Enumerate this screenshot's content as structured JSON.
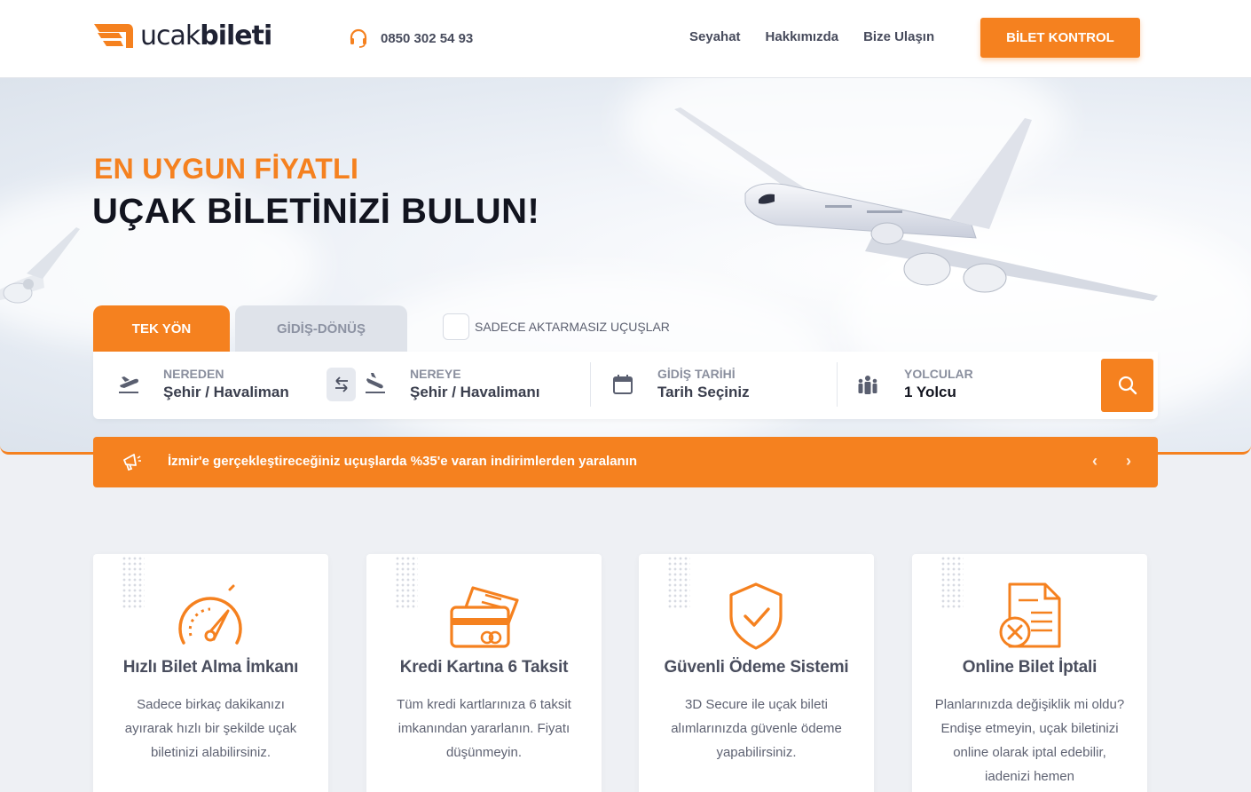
{
  "header": {
    "logo_part1": "ucak",
    "logo_part2": "bileti",
    "phone": "0850 302 54 93",
    "nav": [
      "Seyahat",
      "Hakkımızda",
      "Bize Ulaşın"
    ],
    "cta": "BİLET KONTROL"
  },
  "hero": {
    "subtitle": "EN UYGUN FİYATLI",
    "title": "UÇAK BİLETİNİZİ BULUN!"
  },
  "search": {
    "tabs": [
      "TEK YÖN",
      "GİDİŞ-DÖNÜŞ"
    ],
    "active_tab": "TEK YÖN",
    "direct_only_label": "SADECE AKTARMASIZ UÇUŞLAR",
    "from_label": "NEREDEN",
    "from_value": "Şehir / Havalimanı",
    "to_label": "NEREYE",
    "to_value": "Şehir / Havalimanı",
    "date_label": "GİDİŞ TARİHİ",
    "date_value": "Tarih Seçiniz",
    "pax_label": "YOLCULAR",
    "pax_value": "1 Yolcu"
  },
  "banner": {
    "text": "İzmir'e gerçekleştireceğiniz uçuşlarda %35'e varan indirimlerden yaralanın",
    "prev": "‹",
    "next": "›"
  },
  "features": [
    {
      "icon": "speedometer-icon",
      "title": "Hızlı Bilet Alma İmkanı",
      "desc": "Sadece birkaç dakikanızı ayırarak hızlı bir şekilde uçak biletinizi alabilirsiniz."
    },
    {
      "icon": "credit-card-icon",
      "title": "Kredi Kartına 6 Taksit",
      "desc": "Tüm kredi kartlarınıza 6 taksit imkanından yararlanın. Fiyatı düşünmeyin."
    },
    {
      "icon": "shield-check-icon",
      "title": "Güvenli Ödeme Sistemi",
      "desc": "3D Secure ile uçak bileti alımlarınızda güvenle ödeme yapabilirsiniz."
    },
    {
      "icon": "document-cancel-icon",
      "title": "Online Bilet İptali",
      "desc": "Planlarınızda değişiklik mi oldu? Endişe etmeyin, uçak biletinizi online olarak iptal edebilir, iadenizi hemen"
    }
  ],
  "colors": {
    "accent": "#f5811f",
    "dark": "#12141f",
    "muted": "#8a8f9e"
  }
}
